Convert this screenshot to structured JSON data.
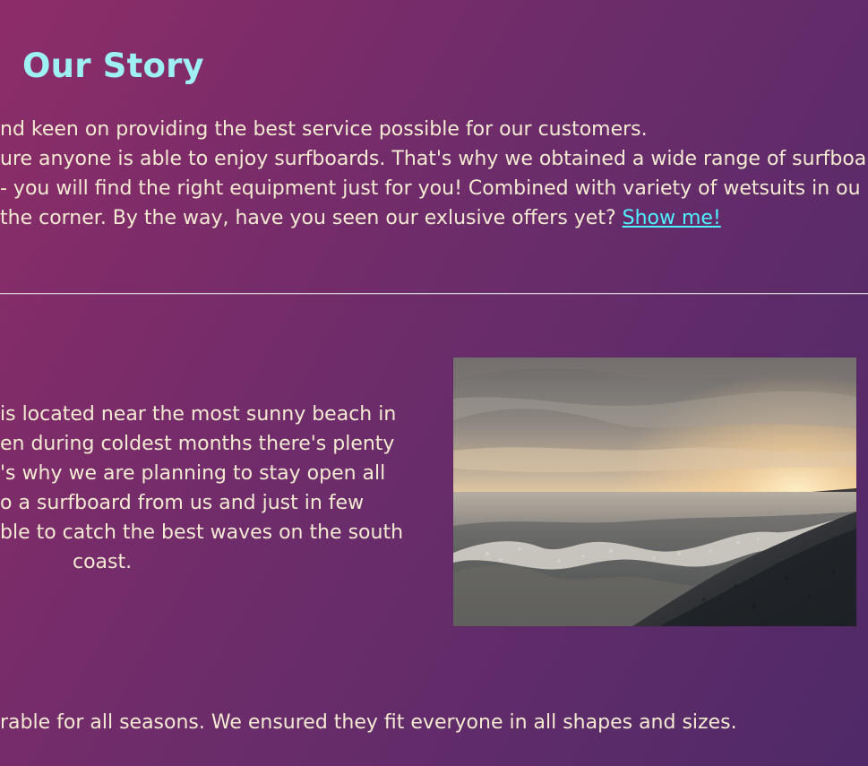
{
  "story": {
    "title": "Our Story",
    "lines": [
      "nd keen on providing the best service possible for our customers.",
      "ure anyone is able to enjoy surfboards. That's why we obtained a wide range of surfboa",
      " - you will find the right equipment just for you! Combined with variety of wetsuits in ou",
      "the corner. By the way, have you seen our exlusive offers yet? "
    ],
    "link_label": "Show me!"
  },
  "location": {
    "lines": [
      "is located near the most sunny beach in",
      "en during coldest months there's plenty",
      "'s why we are planning to stay open all",
      "o a surfboard from us and just in few",
      "ble to catch the best waves on the south",
      "coast."
    ],
    "image_alt": "sunset over the beach"
  },
  "wetsuits": {
    "line": "rable for all seasons. We ensured they fit everyone in all shapes and sizes."
  },
  "colors": {
    "background_start": "#8d2d68",
    "background_end": "#4f2a68",
    "heading": "#9ff0f2",
    "text": "#f4ead2",
    "link": "#4ff2ff"
  }
}
